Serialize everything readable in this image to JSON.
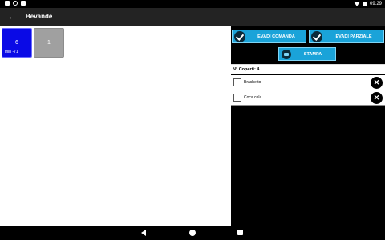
{
  "status_bar": {
    "time": "09:29",
    "icons": [
      "notification-icon",
      "sync-icon",
      "image-icon",
      "wifi-icon",
      "battery-icon"
    ]
  },
  "app_bar": {
    "title": "Bevande",
    "back_icon": "arrow-left-icon"
  },
  "tables": [
    {
      "number": "6",
      "subtitle": "min -71",
      "color": "#0a0ae6"
    },
    {
      "number": "1",
      "subtitle": "",
      "color": "#a0a0a0"
    }
  ],
  "actions": {
    "evadi_comanda": "EVADI COMANDA",
    "evadi_parziale": "EVADI PARZIALE",
    "stampa_comanda": "STAMPA COMANDA",
    "accent": "#1aa3d9"
  },
  "order": {
    "coperti_label": "N° Coperti: 4",
    "items": [
      {
        "name": "Brachetto",
        "checked": false
      },
      {
        "name": "Coca cola",
        "checked": false
      }
    ]
  },
  "nav_bar": {
    "icons": [
      "nav-back-icon",
      "nav-home-icon",
      "nav-recent-icon"
    ]
  }
}
